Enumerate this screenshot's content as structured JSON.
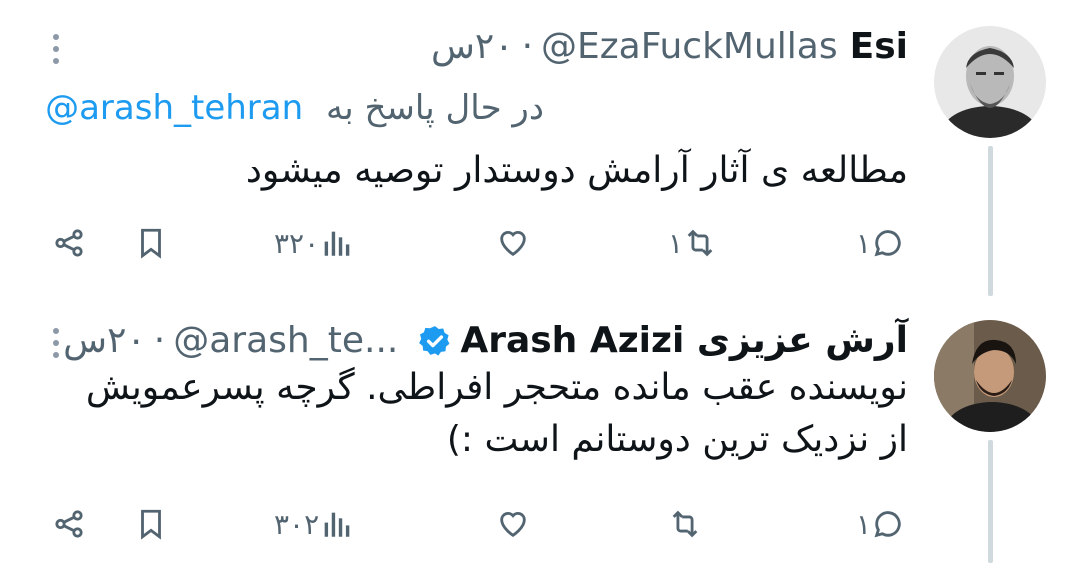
{
  "tweets": [
    {
      "display_name": "Esi",
      "handle": "@EzaFuckMullas",
      "dot": "·",
      "time": "۲۰س",
      "replying_label": "در حال پاسخ به",
      "replying_to": "@arash_tehran",
      "text": "مطالعه ی آثار آرامش دوستدار توصیه میشود",
      "stats": {
        "replies": "۱",
        "retweets": "۱",
        "likes": "",
        "views": "۳۲۰"
      },
      "avatar": "avatar-bearded-man",
      "verified": false
    },
    {
      "display_name": "آرش عزیزی Arash Azizi",
      "handle": "@arash_te...",
      "dot": "·",
      "time": "۲۰س",
      "text": "نویسنده عقب مانده متحجر افراطی. گرچه پسرعمویش از نزدیک ترین دوستانم است :)",
      "stats": {
        "replies": "۱",
        "retweets": "",
        "likes": "",
        "views": "۳۰۲"
      },
      "avatar": "avatar-young-man",
      "verified": true
    }
  ],
  "colors": {
    "text": "#0f1419",
    "secondary": "#536471",
    "accent": "#1d9bf0",
    "line": "#cfd9de"
  },
  "icons": [
    "more-icon",
    "reply-icon",
    "retweet-icon",
    "like-icon",
    "views-icon",
    "bookmark-icon",
    "share-icon",
    "verified-badge-icon"
  ]
}
